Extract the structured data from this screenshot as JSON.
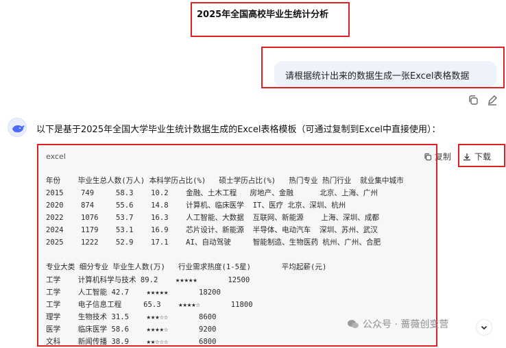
{
  "conversation": {
    "title": "2025年全国高校毕业生统计分析",
    "user_prompt": "请根据统计出来的数据生成一张Excel表格数据",
    "answer_intro": "以下是基于2025年全国大学毕业生统计数据生成的Excel表格模板（可通过复制到Excel中直接使用）："
  },
  "code_block": {
    "language": "excel",
    "copy_label": "复制",
    "download_label": "下载",
    "lines": [
      "年份    毕业生总人数(万人) 本科学历占比(%)   硕士学历占比(%)   热门专业 热门行业  就业集中城市",
      "2015    749     58.3    10.2    金融、土木工程   房地产、金融      北京、上海、广州",
      "2020    874     55.6    14.8    计算机、临床医学  IT、医疗 北京、深圳、杭州",
      "2022    1076    53.7    16.3    人工智能、大数据  互联网、新能源    上海、深圳、成都",
      "2024    1179    53.1    16.9    芯片设计、新能源  半导体、电动汽车  深圳、苏州、武汉",
      "2025    1222    52.9    17.1    AI、自动驾驶     智能制造、生物医药 杭州、广州、合肥",
      "",
      "专业大类 细分专业 毕业生人数(万)   行业需求热度(1-5星)       平均起薪(元)",
      "工学    计算机科学与技术 89.2    ★★★★★       12500",
      "工学    人工智能 42.7    ★★★★★       18200",
      "工学    电子信息工程     65.3    ★★★★☆       11800",
      "理学    生物技术 31.5    ★★★☆☆       8600",
      "医学    临床医学 58.6    ★★★★☆       9200",
      "文科    新闻传播 38.9    ★★☆☆☆       6800"
    ]
  },
  "watermark": "公众号 · 蔷薇创变营",
  "icons": [
    "copy-icon",
    "edit-icon",
    "whale-avatar-icon",
    "download-icon",
    "chevron-down-icon",
    "wechat-icon"
  ]
}
